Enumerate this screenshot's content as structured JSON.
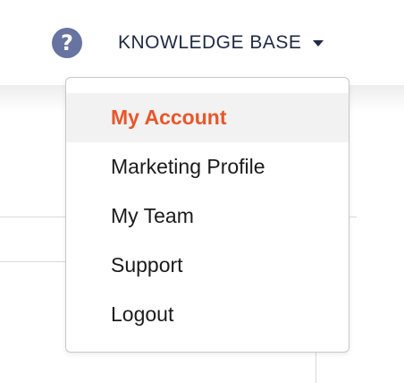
{
  "header": {
    "help_icon": "question-circle-icon",
    "knowledge_base_label": "KNOWLEDGE BASE",
    "caret_icon": "caret-down-icon"
  },
  "dropdown": {
    "items": [
      {
        "label": "My Account",
        "active": true
      },
      {
        "label": "Marketing Profile",
        "active": false
      },
      {
        "label": "My Team",
        "active": false
      },
      {
        "label": "Support",
        "active": false
      },
      {
        "label": "Logout",
        "active": false
      }
    ]
  },
  "colors": {
    "active_item_text": "#e8562a",
    "active_item_bg": "#f2f2f2",
    "nav_text": "#1f2a44",
    "help_icon_bg": "#6773a0"
  }
}
